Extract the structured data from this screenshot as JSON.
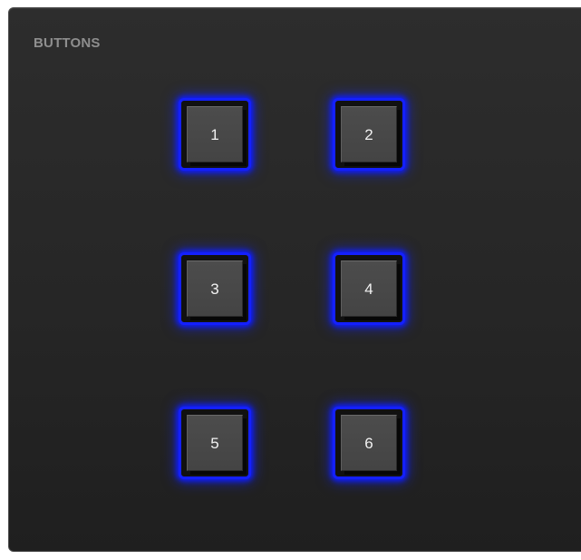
{
  "panel": {
    "title": "BUTTONS"
  },
  "buttons": [
    {
      "label": "1"
    },
    {
      "label": "2"
    },
    {
      "label": "3"
    },
    {
      "label": "4"
    },
    {
      "label": "5"
    },
    {
      "label": "6"
    }
  ],
  "colors": {
    "panel_background": "#272727",
    "panel_border": "#4a4a4a",
    "title_text": "#8e8e8e",
    "button_face": "#474747",
    "button_glow": "#1420ff",
    "button_text": "#f2f2f2"
  }
}
